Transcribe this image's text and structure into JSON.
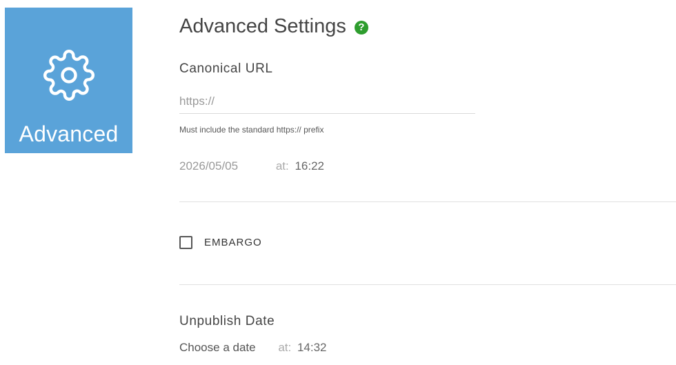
{
  "sidebar": {
    "tab_label": "Advanced",
    "icon": "gear-icon",
    "color": "#5aa3d9"
  },
  "header": {
    "title": "Advanced Settings",
    "help_symbol": "?",
    "help_color": "#2e9d2e"
  },
  "canonical": {
    "label": "Canonical URL",
    "placeholder": "https://",
    "hint": "Must include the standard https:// prefix"
  },
  "publish": {
    "date": "2026/05/05",
    "at_label": "at:",
    "time": "16:22"
  },
  "embargo": {
    "label": "EMBARGO",
    "checked": false
  },
  "unpublish": {
    "label": "Unpublish Date",
    "date_placeholder": "Choose a date",
    "at_label": "at:",
    "time": "14:32"
  }
}
